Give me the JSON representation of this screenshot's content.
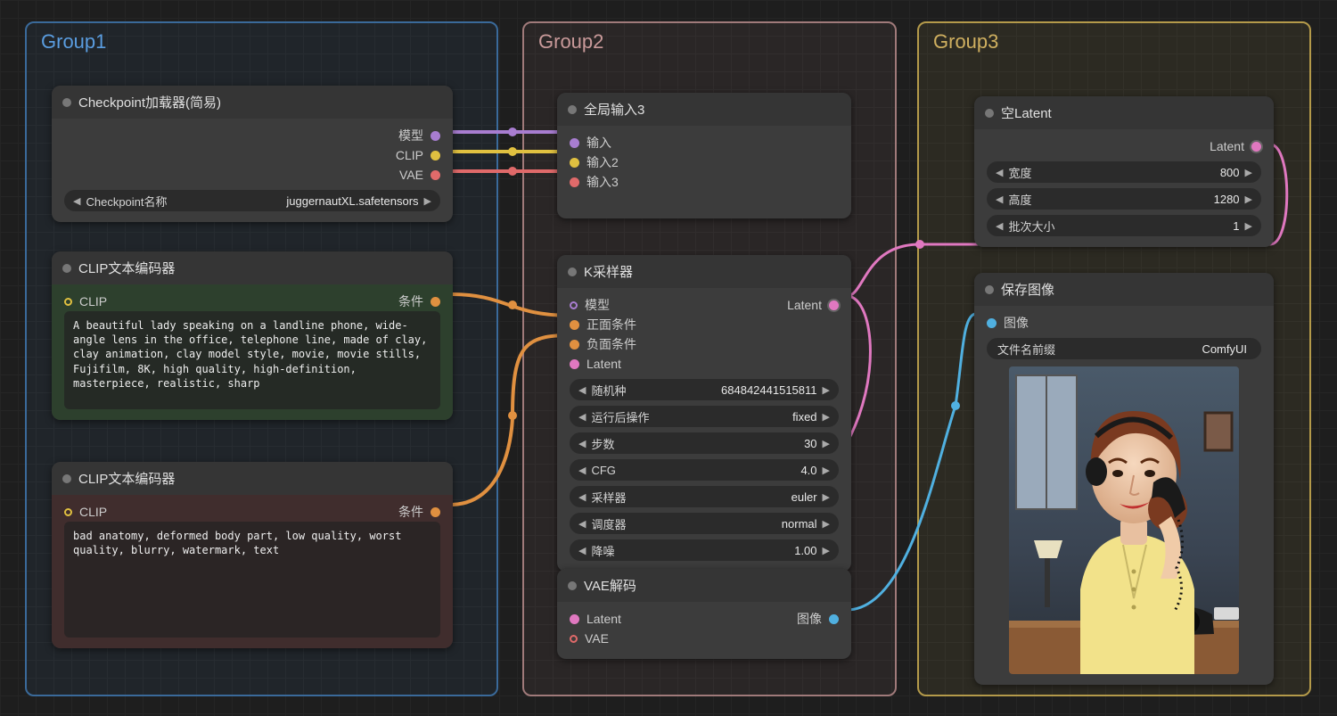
{
  "groups": {
    "g1": "Group1",
    "g2": "Group2",
    "g3": "Group3"
  },
  "checkpoint": {
    "title": "Checkpoint加载器(简易)",
    "out_model": "模型",
    "out_clip": "CLIP",
    "out_vae": "VAE",
    "widget_label": "Checkpoint名称",
    "widget_value": "juggernautXL.safetensors"
  },
  "clip_pos": {
    "title": "CLIP文本编码器",
    "in_clip": "CLIP",
    "out_cond": "条件",
    "text": "A beautiful lady speaking on a landline phone, wide-angle lens in the office, telephone line, made of clay, clay animation, clay model style, movie, movie stills, Fujifilm, 8K, high quality, high-definition, masterpiece, realistic, sharp"
  },
  "clip_neg": {
    "title": "CLIP文本编码器",
    "in_clip": "CLIP",
    "out_cond": "条件",
    "text": "bad anatomy, deformed body part, low quality, worst quality, blurry, watermark, text"
  },
  "global_in": {
    "title": "全局输入3",
    "in1": "输入",
    "in2": "输入2",
    "in3": "输入3"
  },
  "ksampler": {
    "title": "K采样器",
    "in_model": "模型",
    "in_pos": "正面条件",
    "in_neg": "负面条件",
    "in_latent": "Latent",
    "out_latent": "Latent",
    "seed_label": "随机种",
    "seed_value": "684842441515811",
    "after_label": "运行后操作",
    "after_value": "fixed",
    "steps_label": "步数",
    "steps_value": "30",
    "cfg_label": "CFG",
    "cfg_value": "4.0",
    "sampler_label": "采样器",
    "sampler_value": "euler",
    "sched_label": "调度器",
    "sched_value": "normal",
    "denoise_label": "降噪",
    "denoise_value": "1.00"
  },
  "vae_decode": {
    "title": "VAE解码",
    "in_latent": "Latent",
    "in_vae": "VAE",
    "out_image": "图像"
  },
  "empty_latent": {
    "title": "空Latent",
    "out_latent": "Latent",
    "width_label": "宽度",
    "width_value": "800",
    "height_label": "高度",
    "height_value": "1280",
    "batch_label": "批次大小",
    "batch_value": "1"
  },
  "save_image": {
    "title": "保存图像",
    "in_image": "图像",
    "prefix_label": "文件名前缀",
    "prefix_value": "ComfyUI"
  }
}
